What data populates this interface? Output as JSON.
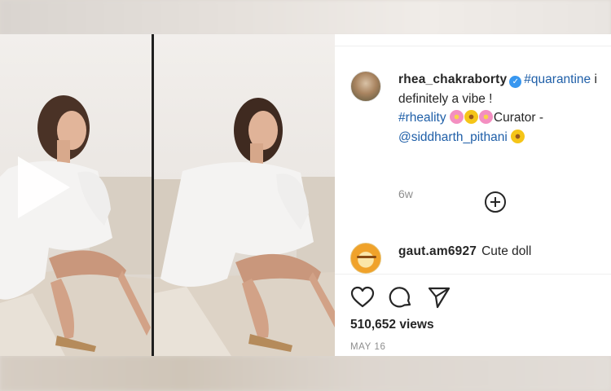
{
  "post": {
    "username": "rhea_chakraborty",
    "caption": {
      "hashtag1": "#quarantine",
      "tail1": "i",
      "line2": "definitely a vibe !",
      "hashtag2": "#rheality",
      "curator_label": "Curator -",
      "mention": "@siddharth_pithani"
    },
    "time_ago": "6w",
    "comment": {
      "username": "gaut.am6927",
      "text": "Cute doll"
    },
    "views": "510,652 views",
    "date": "MAY 16",
    "icons": {
      "verified": "verified-badge-icon",
      "play": "play-icon",
      "load_more": "plus-circle-icon",
      "like": "heart-icon",
      "comment": "speech-bubble-icon",
      "share": "paper-plane-icon"
    },
    "colors": {
      "link": "#1f5fa8",
      "verified": "#3897f0",
      "text": "#262626",
      "muted": "#8e8e8e"
    }
  }
}
